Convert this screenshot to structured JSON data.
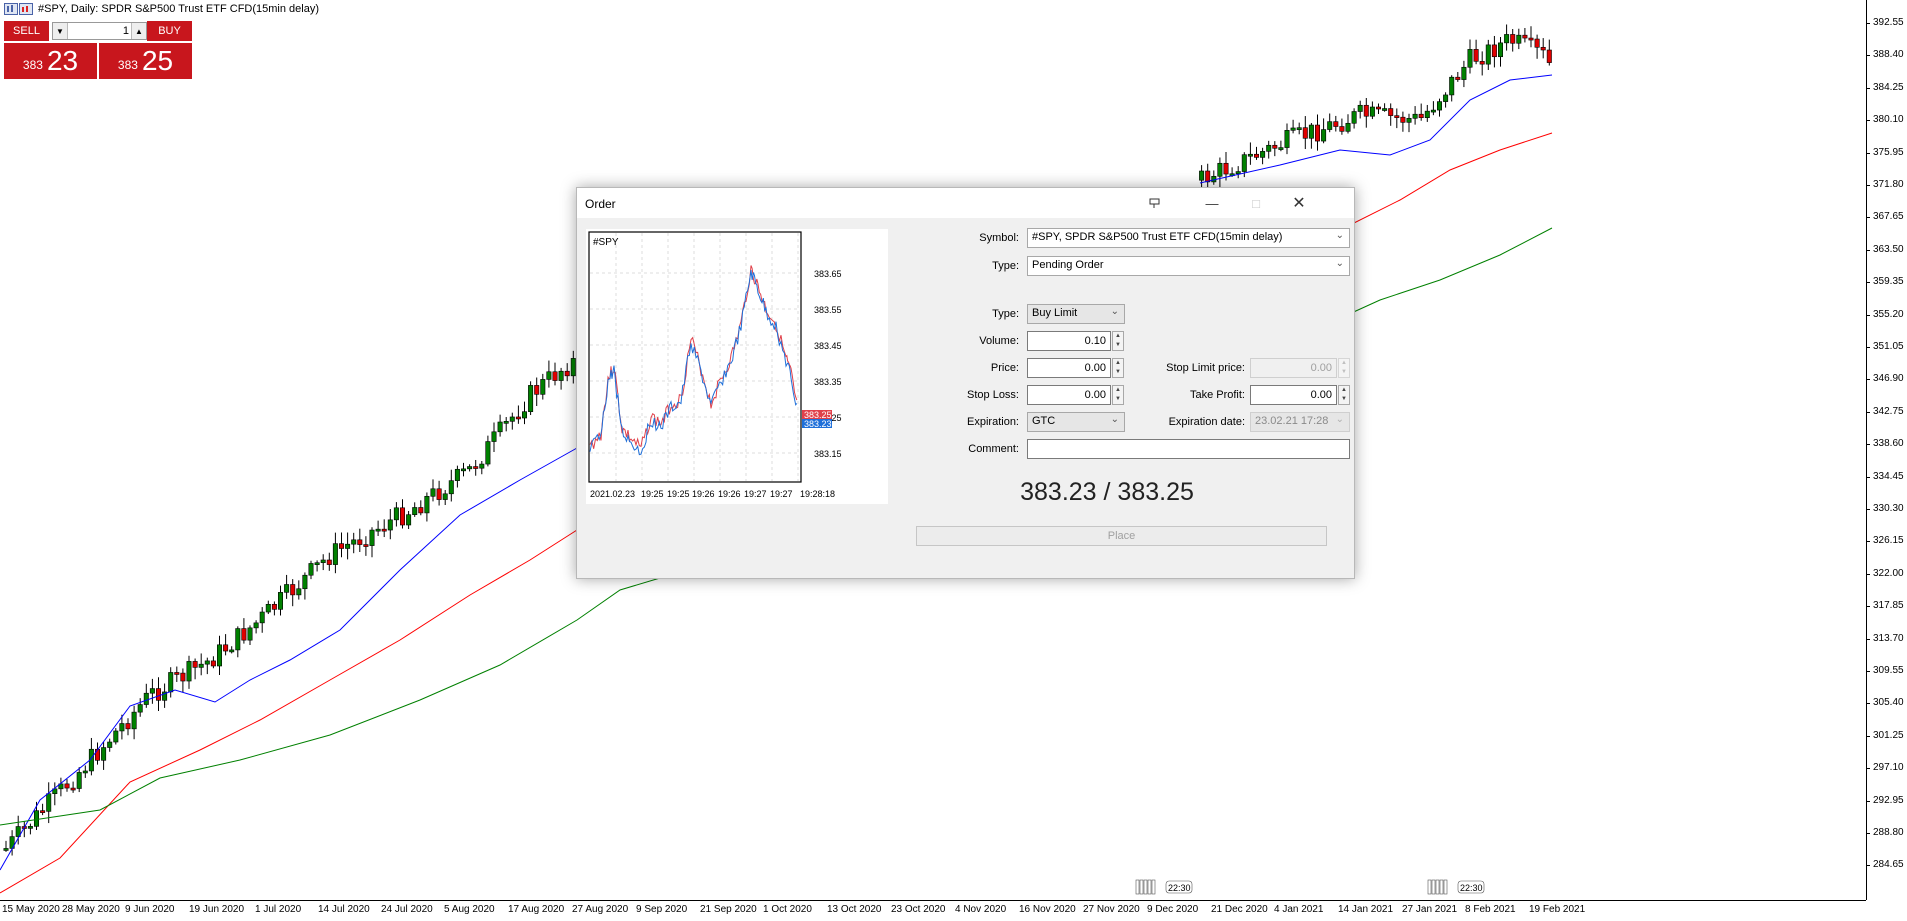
{
  "chart": {
    "title": "#SPY, Daily:  SPDR S&P500 Trust ETF CFD(15min delay)",
    "y_ticks": [
      "392.55",
      "388.40",
      "384.25",
      "380.10",
      "375.95",
      "371.80",
      "367.65",
      "363.50",
      "359.35",
      "355.20",
      "351.05",
      "346.90",
      "342.75",
      "338.60",
      "334.45",
      "330.30",
      "326.15",
      "322.00",
      "317.85",
      "313.70",
      "309.55",
      "305.40",
      "301.25",
      "297.10",
      "292.95",
      "288.80",
      "284.65"
    ],
    "x_ticks": [
      "15 May 2020",
      "28 May 2020",
      "9 Jun 2020",
      "19 Jun 2020",
      "1 Jul 2020",
      "14 Jul 2020",
      "24 Jul 2020",
      "5 Aug 2020",
      "17 Aug 2020",
      "27 Aug 2020",
      "9 Sep 2020",
      "21 Sep 2020",
      "1 Oct 2020",
      "13 Oct 2020",
      "23 Oct 2020",
      "4 Nov 2020",
      "16 Nov 2020",
      "27 Nov 2020",
      "9 Dec 2020",
      "21 Dec 2020",
      "4 Jan 2021",
      "14 Jan 2021",
      "27 Jan 2021",
      "8 Feb 2021",
      "19 Feb 2021"
    ],
    "event_labels": [
      "22:30",
      "22:30"
    ],
    "colors": {
      "bull": "#008000",
      "bear": "#e00000",
      "ma_fast": "#0000ff",
      "ma_mid": "#ff0000",
      "ma_slow": "#008000"
    }
  },
  "trade_panel": {
    "sell_label": "SELL",
    "buy_label": "BUY",
    "lot_value": "1",
    "sell_price_small": "383",
    "sell_price_big": "23",
    "buy_price_small": "383",
    "buy_price_big": "25"
  },
  "dialog": {
    "title": "Order",
    "symbol_label": "Symbol:",
    "symbol_value": "#SPY, SPDR S&P500 Trust ETF CFD(15min delay)",
    "type_label": "Type:",
    "type_value": "Pending Order",
    "order_type_label": "Type:",
    "order_type_value": "Buy Limit",
    "volume_label": "Volume:",
    "volume_value": "0.10",
    "price_label": "Price:",
    "price_value": "0.00",
    "stop_limit_label": "Stop Limit price:",
    "stop_limit_value": "0.00",
    "stop_loss_label": "Stop Loss:",
    "stop_loss_value": "0.00",
    "take_profit_label": "Take Profit:",
    "take_profit_value": "0.00",
    "expiration_label": "Expiration:",
    "expiration_value": "GTC",
    "expiration_date_label": "Expiration date:",
    "expiration_date_value": "23.02.21 17:28",
    "comment_label": "Comment:",
    "comment_value": "",
    "quote": "383.23 / 383.25",
    "place_label": "Place",
    "mini_chart": {
      "symbol": "#SPY",
      "y_ticks": [
        "383.65",
        "383.55",
        "383.45",
        "383.35",
        "383.25",
        "383.15"
      ],
      "x_ticks": [
        "2021.02.23",
        "19:25",
        "19:25",
        "19:26",
        "19:26",
        "19:27",
        "19:27",
        "19:28:18"
      ],
      "ask_label": "383.25",
      "bid_label": "383.23",
      "ask_color": "#e0404a",
      "bid_color": "#1e6fd9"
    }
  }
}
